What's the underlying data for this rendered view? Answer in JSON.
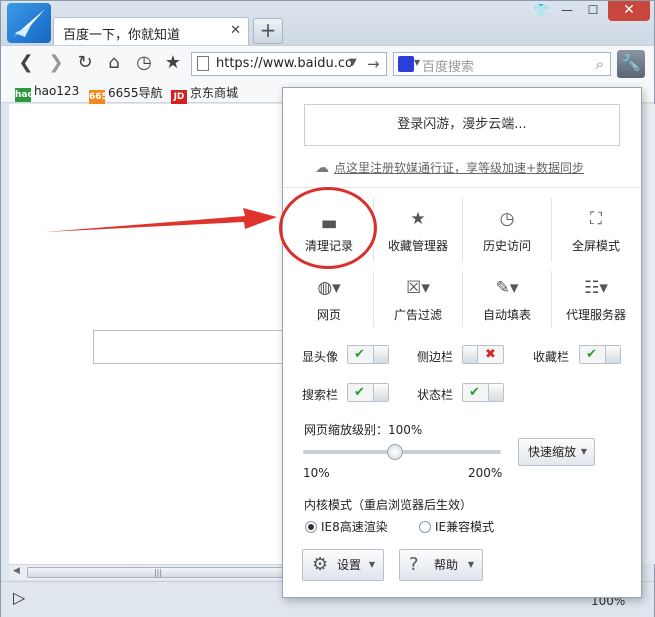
{
  "browser": {
    "tab_title": "百度一下，你就知道",
    "tab_close": "✕",
    "new_tab": "+",
    "window_controls": {
      "skin": "👕",
      "minimize": "—",
      "maximize": "☐",
      "close": "✕"
    }
  },
  "toolbar": {
    "url": "https://www.baidu.co",
    "search_placeholder": "百度搜索",
    "icons": [
      "back-icon",
      "forward-icon",
      "refresh-icon",
      "home-icon",
      "history-icon",
      "star-icon",
      "wrench-icon"
    ]
  },
  "bookmarks": [
    {
      "label": "hao123",
      "icon_text": "hao",
      "color": "#2c9a3c"
    },
    {
      "label": "6655导航",
      "icon_text": "6655",
      "color": "#f08a1c"
    },
    {
      "label": "京东商城",
      "icon_text": "JD",
      "color": "#d3221e"
    }
  ],
  "panel": {
    "login_button": "登录闪游，漫步云端...",
    "register_link": "点这里注册软媒通行证，享等级加速+数据同步",
    "grid_row1": [
      {
        "label": "清理记录",
        "icon": "broom-icon"
      },
      {
        "label": "收藏管理器",
        "icon": "favorites-icon"
      },
      {
        "label": "历史访问",
        "icon": "clock-icon"
      },
      {
        "label": "全屏模式",
        "icon": "fullscreen-icon"
      }
    ],
    "grid_row2": [
      {
        "label": "网页",
        "icon": "globe-icon"
      },
      {
        "label": "广告过滤",
        "icon": "ad-filter-icon"
      },
      {
        "label": "自动填表",
        "icon": "autofill-icon"
      },
      {
        "label": "代理服务器",
        "icon": "proxy-icon"
      }
    ],
    "toggles": [
      {
        "label": "显头像",
        "on": true
      },
      {
        "label": "侧边栏",
        "on": false
      },
      {
        "label": "收藏栏",
        "on": true
      },
      {
        "label": "搜索栏",
        "on": true
      },
      {
        "label": "状态栏",
        "on": true
      }
    ],
    "zoom": {
      "label": "网页缩放级别：100%",
      "level_percent": 100,
      "min": "10%",
      "max": "200%",
      "quick_zoom": "快速缩放"
    },
    "kernel": {
      "label": "内核模式（重启浏览器后生效）",
      "options": [
        "IE8高速渲染",
        "IE兼容模式"
      ],
      "selected": "IE8高速渲染"
    },
    "settings_button": "设置",
    "help_button": "帮助"
  },
  "annotation_colors": {
    "arrow": "#e0332d",
    "circle": "#d9302b"
  },
  "status": {
    "zoom_text": "100%"
  }
}
